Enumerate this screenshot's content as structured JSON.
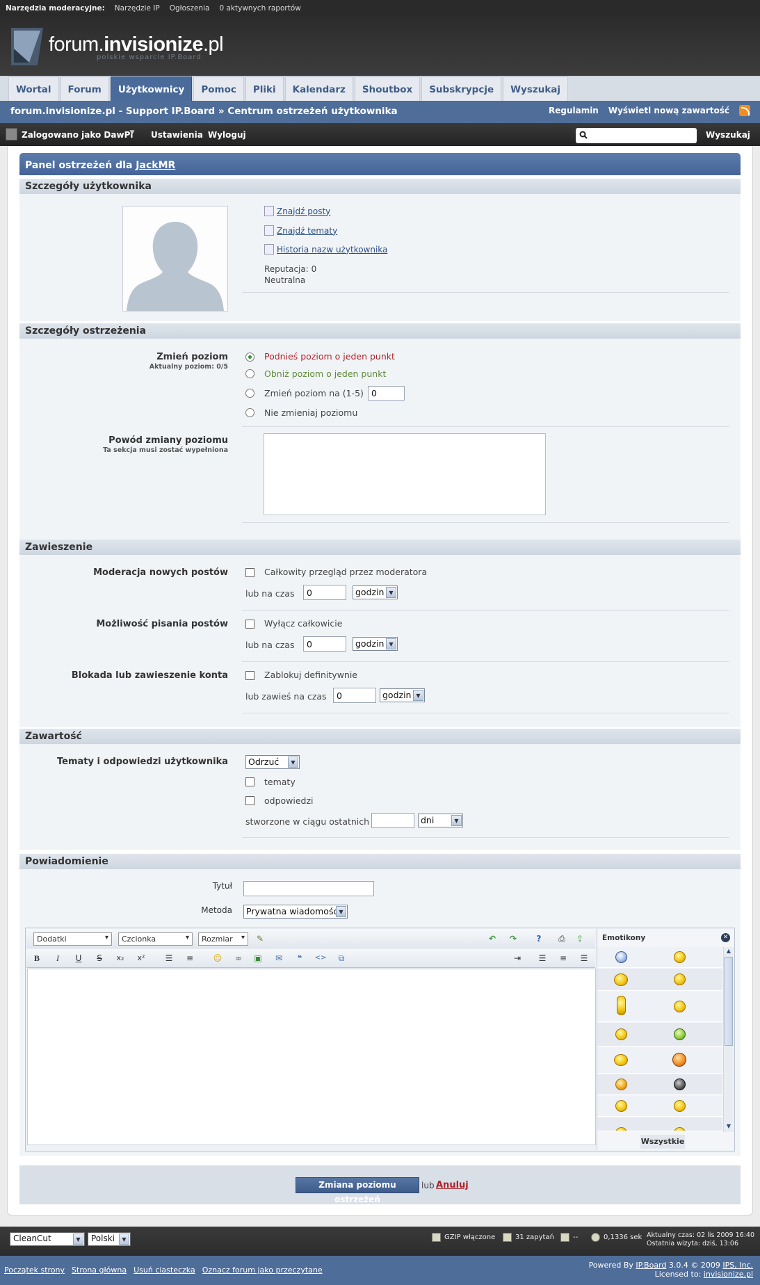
{
  "modbar": {
    "label": "Narzędzia moderacyjne:",
    "items": [
      "Narzędzie IP",
      "Ogłoszenia",
      "0 aktywnych raportów"
    ]
  },
  "logo": {
    "brand_plain": "forum.",
    "brand_bold": "invisionize",
    "brand_tld": ".pl",
    "subtitle": "polskie wsparcie IP.Board"
  },
  "nav": {
    "tabs": [
      "Wortal",
      "Forum",
      "Użytkownicy",
      "Pomoc",
      "Pliki",
      "Kalendarz",
      "Shoutbox",
      "Subskrypcje",
      "Wyszukaj"
    ],
    "active": "Użytkownicy"
  },
  "breadcrumb": {
    "text": "forum.invisionize.pl - Support IP.Board  » Centrum ostrzeżeń użytkownika",
    "links": [
      "Regulamin",
      "Wyświetl nową zawartość"
    ]
  },
  "userbar": {
    "logged_in": "Zalogowano jako DawPi",
    "settings": "Ustawienia",
    "logout": "Wyloguj",
    "search_button": "Wyszukaj",
    "search_value": ""
  },
  "panel": {
    "title_prefix": "Panel ostrzeżeń dla ",
    "username": "JackMR"
  },
  "user_details": {
    "header": "Szczegóły użytkownika",
    "links": [
      "Znajdź posty",
      "Znajdź tematy",
      "Historia nazw użytkownika"
    ],
    "reputation": "Reputacja: 0",
    "reputation_label": "Neutralna"
  },
  "warn_details": {
    "header": "Szczegóły ostrzeżenia",
    "change_label": "Zmień poziom",
    "current_level": "Aktualny poziom: 0/5",
    "options": [
      "Podnieś poziom o jeden punkt",
      "Obniż poziom o jeden punkt",
      "Zmień poziom na (1-5)",
      "Nie zmieniaj poziomu"
    ],
    "level_value": "0",
    "reason_label": "Powód zmiany poziomu",
    "reason_note": "Ta sekcja musi zostać wypełniona",
    "reason_value": "",
    "colors": {
      "raise": "#b0232a",
      "lower": "#5f8b3a"
    }
  },
  "suspension": {
    "header": "Zawieszenie",
    "rows": [
      {
        "label": "Moderacja nowych postów",
        "check": "Całkowity przegląd przez moderatora",
        "time_label": "lub na czas",
        "value": "0",
        "unit": "godzin"
      },
      {
        "label": "Możliwość pisania postów",
        "check": "Wyłącz całkowicie",
        "time_label": "lub na czas",
        "value": "0",
        "unit": "godzin"
      },
      {
        "label": "Blokada lub zawieszenie konta",
        "check": "Zablokuj definitywnie",
        "time_label": "lub zawieś na czas",
        "value": "0",
        "unit": "godzin"
      }
    ]
  },
  "content": {
    "header": "Zawartość",
    "label": "Tematy i odpowiedzi użytkownika",
    "action": "Odrzuć",
    "checks": [
      "tematy",
      "odpowiedzi"
    ],
    "created_label": "stworzone w ciągu ostatnich",
    "created_value": "",
    "created_unit": "dni"
  },
  "notification": {
    "header": "Powiadomienie",
    "title_label": "Tytuł",
    "title_value": "",
    "method_label": "Metoda",
    "method_value": "Prywatna wiadomość"
  },
  "editor": {
    "selects": [
      "Dodatki",
      "Czcionka",
      "Rozmiar"
    ],
    "emoticons_title": "Emotikony",
    "emoticons_all": "Wszystkie"
  },
  "submit": {
    "button": "Zmiana poziomu ostrzeżeń",
    "or": "lub",
    "cancel": "Anuluj"
  },
  "footer": {
    "skin": "CleanCut",
    "language": "Polski",
    "stats": [
      "GZIP włączone",
      "31 zapytań",
      "--",
      "0,1336 sek"
    ],
    "time_now": "Aktualny czas: 02 lis 2009 16:40",
    "last_visit": "Ostatnia wizyta: dziś, 13:06",
    "links": [
      "Początek strony",
      "Strona główna",
      "Usuń ciasteczka",
      "Oznacz forum jako przeczytane"
    ],
    "powered_prefix": "Powered By ",
    "powered_link": "IP.Board",
    "powered_version": " 3.0.4 © 2009  ",
    "powered_company": "IPS, Inc.",
    "licensed_prefix": "Licensed to: ",
    "licensed_link": "invisionize.pl"
  },
  "brand_colors": {
    "header_dark": "#2c2c2c",
    "nav_blue": "#4f6d99",
    "section_bg": "#f1f4f7"
  }
}
